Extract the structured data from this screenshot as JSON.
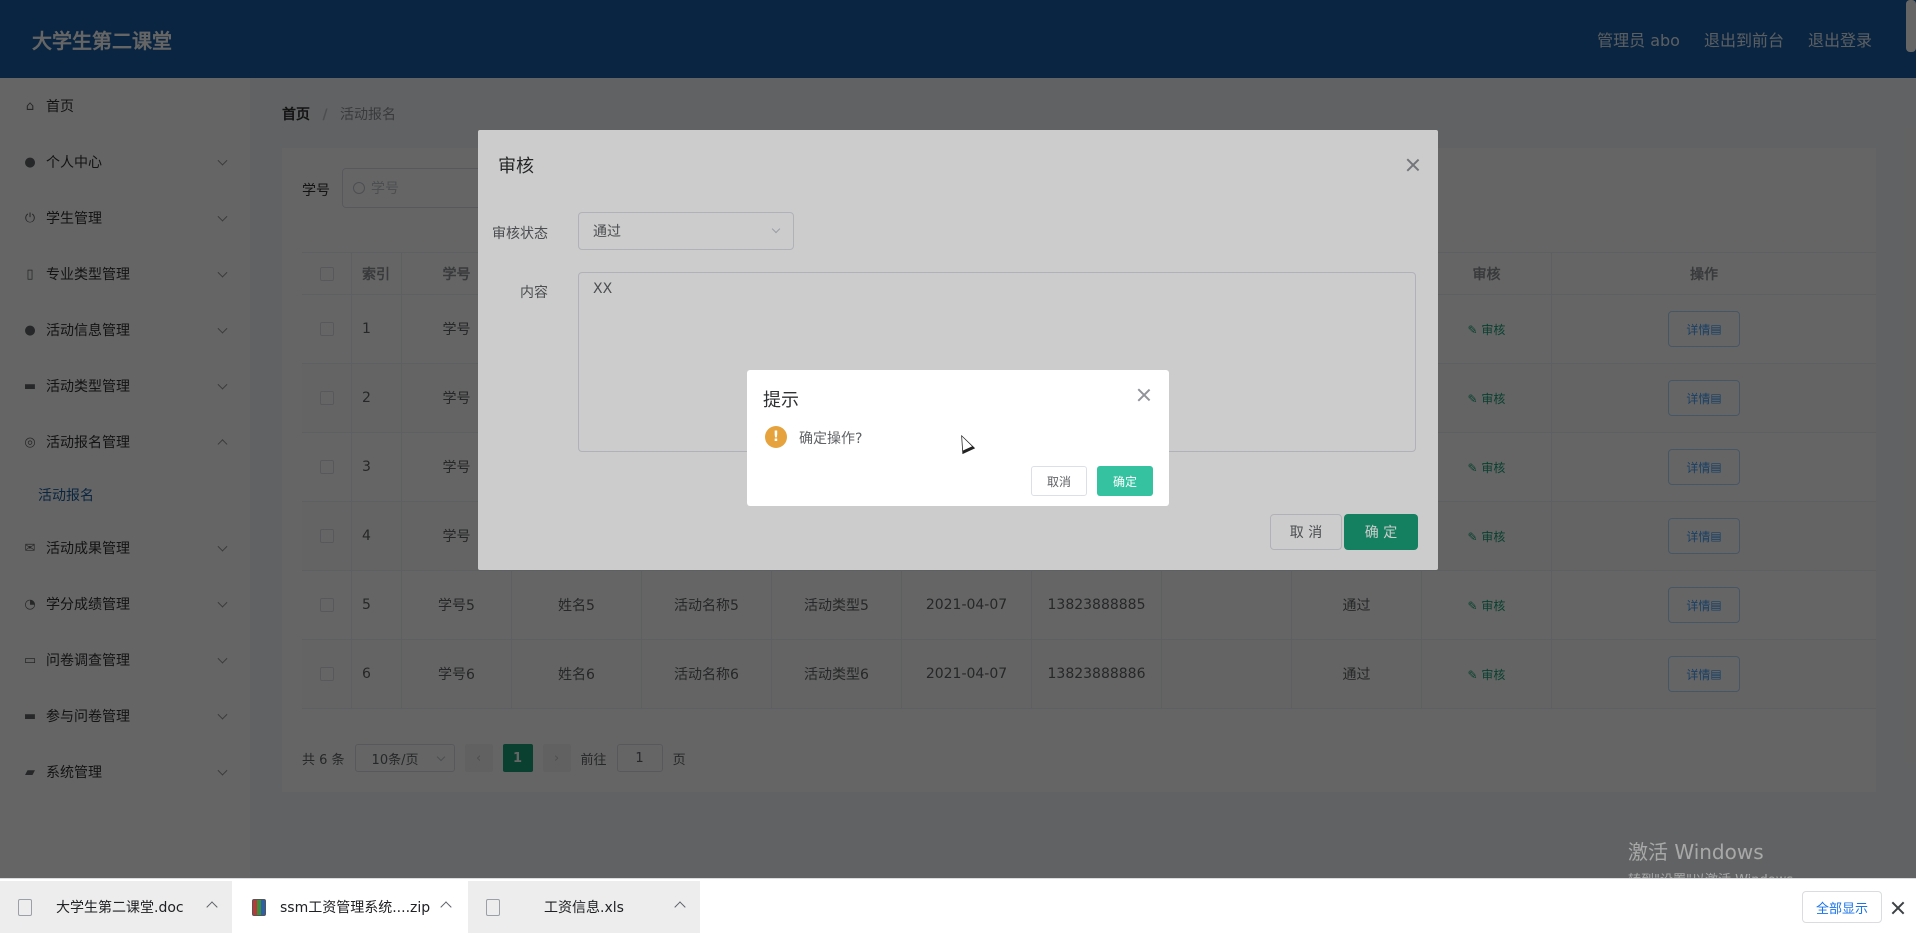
{
  "header": {
    "brand": "大学生第二课堂",
    "admin": "管理员 abo",
    "to_front": "退出到前台",
    "logout": "退出登录"
  },
  "sidebar": {
    "items": [
      {
        "label": "首页",
        "icon": "home-icon"
      },
      {
        "label": "个人中心",
        "icon": "user-icon"
      },
      {
        "label": "学生管理",
        "icon": "power-icon"
      },
      {
        "label": "专业类型管理",
        "icon": "phone-icon"
      },
      {
        "label": "活动信息管理",
        "icon": "location-icon"
      },
      {
        "label": "活动类型管理",
        "icon": "monitor-icon"
      },
      {
        "label": "活动报名管理",
        "icon": "target-icon"
      },
      {
        "label": "活动成果管理",
        "icon": "mail-icon"
      },
      {
        "label": "学分成绩管理",
        "icon": "compass-icon"
      },
      {
        "label": "问卷调查管理",
        "icon": "chat-icon"
      },
      {
        "label": "参与问卷管理",
        "icon": "monitor-icon"
      },
      {
        "label": "系统管理",
        "icon": "briefcase-icon"
      }
    ],
    "active_sub": "活动报名"
  },
  "breadcrumb": {
    "home": "首页",
    "sep": "/",
    "current": "活动报名"
  },
  "search": {
    "label": "学号",
    "placeholder": "学号"
  },
  "table": {
    "headers": {
      "index": "索引",
      "no": "学号",
      "audit": "审核",
      "ops": "操作"
    },
    "rows": [
      {
        "index": "1",
        "no": "学号"
      },
      {
        "index": "2",
        "no": "学号"
      },
      {
        "index": "3",
        "no": "学号"
      },
      {
        "index": "4",
        "no": "学号"
      },
      {
        "index": "5",
        "no": "学号5",
        "name": "姓名5",
        "activity": "活动名称5",
        "type": "活动类型5",
        "date": "2021-04-07",
        "phone": "13823888885",
        "status": "通过"
      },
      {
        "index": "6",
        "no": "学号6",
        "name": "姓名6",
        "activity": "活动名称6",
        "type": "活动类型6",
        "date": "2021-04-07",
        "phone": "13823888886",
        "status": "通过"
      }
    ],
    "audit_link": "审核",
    "detail_btn": "详情"
  },
  "pager": {
    "total": "共 6 条",
    "size": "10条/页",
    "page": "1",
    "goto": "前往",
    "goto_value": "1",
    "page_unit": "页"
  },
  "audit_dialog": {
    "title": "审核",
    "status_label": "审核状态",
    "status_value": "通过",
    "content_label": "内容",
    "content_value": "XX",
    "cancel": "取 消",
    "ok": "确 定"
  },
  "confirm_box": {
    "title": "提示",
    "message": "确定操作?",
    "cancel": "取消",
    "ok": "确定"
  },
  "watermark": {
    "line1": "激活 Windows",
    "line2": "转到\"设置\"以激活 Windows。"
  },
  "downloads": {
    "items": [
      {
        "name": "大学生第二课堂.doc"
      },
      {
        "name": "ssm工资管理系统....zip"
      },
      {
        "name": "工资信息.xls"
      }
    ],
    "show_all": "全部显示"
  },
  "colors": {
    "header": "#1a5fa4",
    "primary": "#1aa179",
    "warning": "#e6a23c"
  }
}
